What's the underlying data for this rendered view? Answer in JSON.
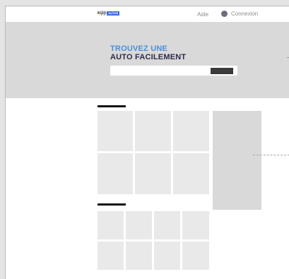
{
  "header": {
    "logo_word": "kijiji",
    "logo_badge": "AUTOS",
    "help_label": "Aide",
    "login_label": "Connexion"
  },
  "hero": {
    "title_line1": "TROUVEZ UNE",
    "title_line2": "AUTO FACILEMENT",
    "search_placeholder": "",
    "search_button_label": ""
  },
  "sections": [
    {
      "name": "section-1",
      "tiles": 6
    },
    {
      "name": "section-2",
      "tiles": 8
    }
  ],
  "colors": {
    "hero_background": "#d9d9d9",
    "title_accent": "#4a8fdc",
    "title_dark": "#2e2c4d",
    "logo_badge": "#3a6fd8"
  }
}
